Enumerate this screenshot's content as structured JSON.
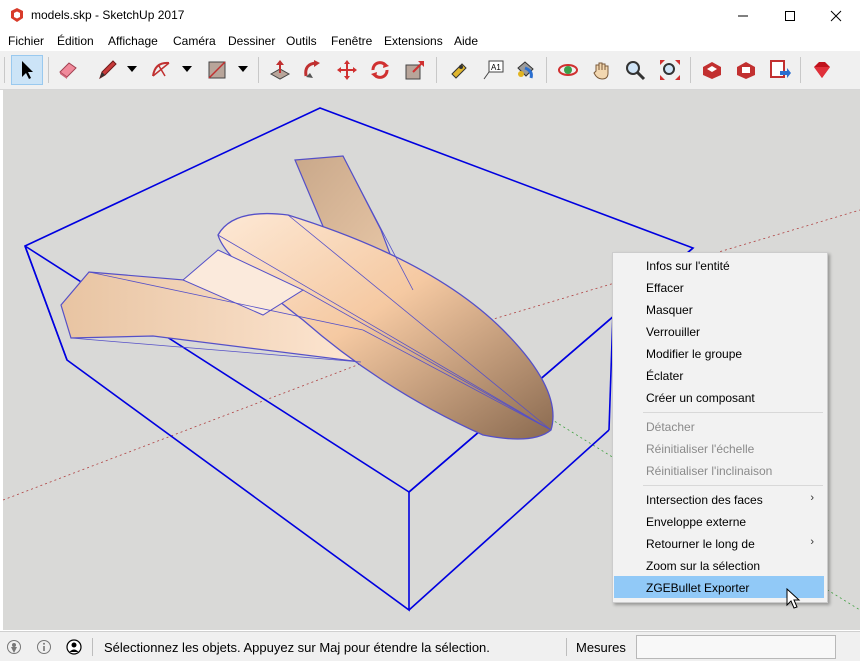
{
  "window": {
    "title": "models.skp - SketchUp 2017",
    "minimize": "—",
    "maximize": "☐",
    "close": "✕"
  },
  "menu": [
    "Fichier",
    "Édition",
    "Affichage",
    "Caméra",
    "Dessiner",
    "Outils",
    "Fenêtre",
    "Extensions",
    "Aide"
  ],
  "toolbar": {
    "tools": [
      "select",
      "eraser",
      "pencil",
      "arc",
      "rectangle",
      "push-pull",
      "follow-me",
      "move",
      "rotate",
      "scale",
      "tape-measure",
      "text",
      "paint-bucket",
      "orbit",
      "pan",
      "zoom",
      "zoom-extents",
      "3d-warehouse",
      "extension-warehouse",
      "send-to-layout",
      "ruby-console"
    ]
  },
  "context_menu": {
    "items": [
      {
        "label": "Infos sur l'entité",
        "enabled": true
      },
      {
        "label": "Effacer",
        "enabled": true
      },
      {
        "label": "Masquer",
        "enabled": true
      },
      {
        "label": "Verrouiller",
        "enabled": true
      },
      {
        "label": "Modifier le groupe",
        "enabled": true
      },
      {
        "label": "Éclater",
        "enabled": true
      },
      {
        "label": "Créer un composant",
        "enabled": true
      },
      {
        "label": "Détacher",
        "enabled": false
      },
      {
        "label": "Réinitialiser l'échelle",
        "enabled": false
      },
      {
        "label": "Réinitialiser l'inclinaison",
        "enabled": false
      },
      {
        "label": "Intersection des faces",
        "enabled": true,
        "submenu": true
      },
      {
        "label": "Enveloppe externe",
        "enabled": true
      },
      {
        "label": "Retourner le long de",
        "enabled": true,
        "submenu": true
      },
      {
        "label": "Zoom sur la sélection",
        "enabled": true
      },
      {
        "label": "ZGEBullet Exporter",
        "enabled": true,
        "highlighted": true
      }
    ],
    "submenu_arrow": "›"
  },
  "status": {
    "message": "Sélectionnez les objets. Appuyez sur Maj pour étendre la sélection.",
    "measures_label": "Mesures",
    "measures_value": ""
  },
  "colors": {
    "selection_box": "#0000e0",
    "model_fill": "#f3c9a4",
    "viewport_bg": "#d9d9d7",
    "menu_highlight": "#91c9f7"
  }
}
